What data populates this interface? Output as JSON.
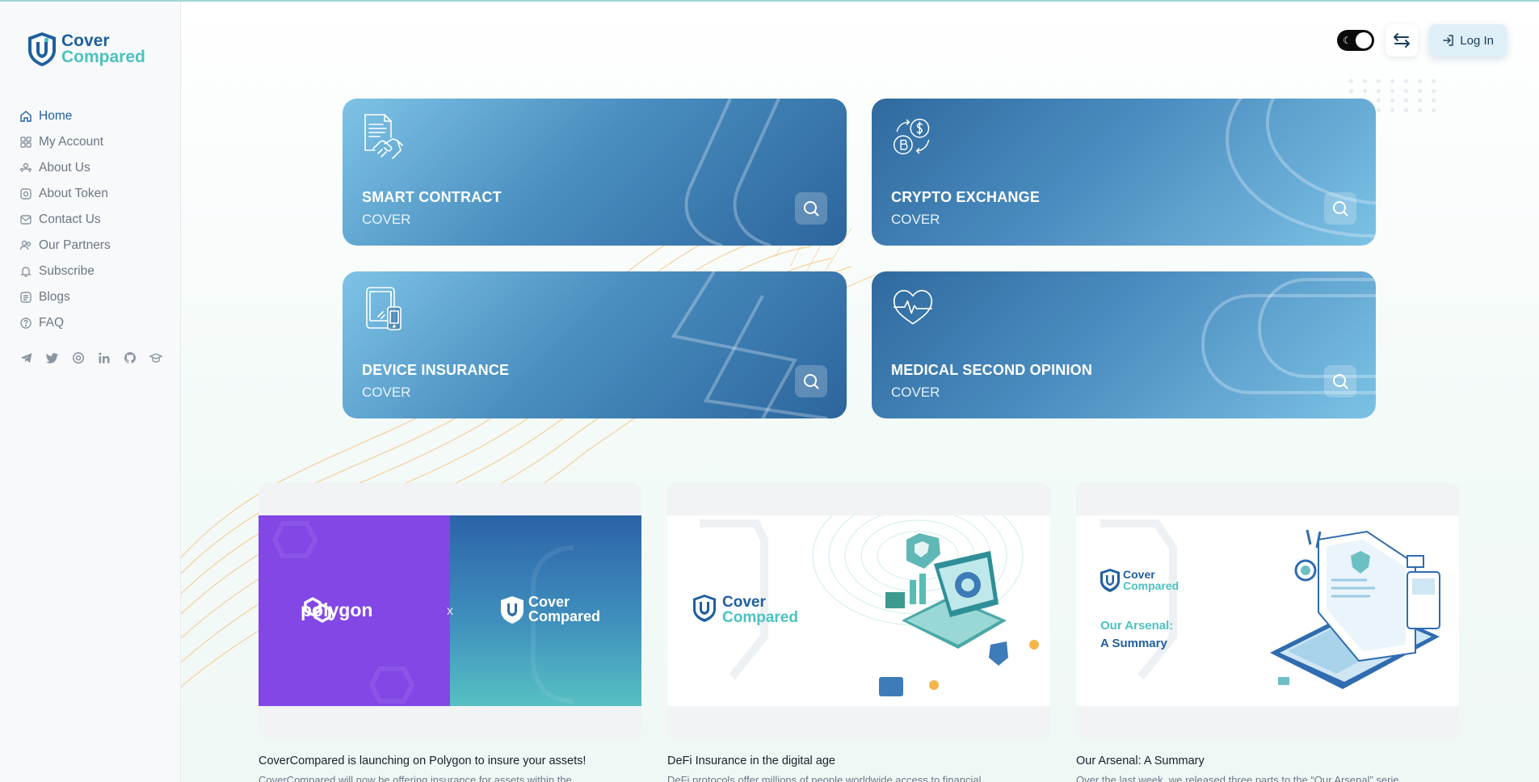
{
  "brand": {
    "line1": "Cover",
    "line2": "Compared"
  },
  "nav": [
    {
      "label": "Home",
      "icon": "home-icon",
      "active": true
    },
    {
      "label": "My Account",
      "icon": "grid-icon"
    },
    {
      "label": "About Us",
      "icon": "users-icon"
    },
    {
      "label": "About Token",
      "icon": "token-icon"
    },
    {
      "label": "Contact Us",
      "icon": "mail-icon"
    },
    {
      "label": "Our Partners",
      "icon": "partners-icon"
    },
    {
      "label": "Subscribe",
      "icon": "bell-icon"
    },
    {
      "label": "Blogs",
      "icon": "blog-icon"
    },
    {
      "label": "FAQ",
      "icon": "help-icon"
    }
  ],
  "socials": [
    "telegram-icon",
    "twitter-icon",
    "instagram-icon",
    "linkedin-icon",
    "github-icon",
    "education-icon"
  ],
  "topbar": {
    "login_label": "Log In",
    "theme_icon": "☾"
  },
  "covers": [
    {
      "title": "SMART CONTRACT",
      "subtitle": "COVER",
      "icon": "contract-handshake-icon"
    },
    {
      "title": "CRYPTO EXCHANGE",
      "subtitle": "COVER",
      "icon": "crypto-exchange-icon"
    },
    {
      "title": "DEVICE INSURANCE",
      "subtitle": "COVER",
      "icon": "device-icon"
    },
    {
      "title": "MEDICAL SECOND OPINION",
      "subtitle": "COVER",
      "icon": "heart-pulse-icon"
    }
  ],
  "blogs": [
    {
      "title": "CoverCompared is launching on Polygon to insure your assets!",
      "excerpt": "CoverCompared will now be offering insurance for assets within the",
      "image_text": {
        "left": "polygon",
        "x": "x",
        "brand1": "Cover",
        "brand2": "Compared"
      }
    },
    {
      "title": "DeFi Insurance in the digital age",
      "excerpt": "DeFi protocols offer millions of people worldwide access to financial",
      "image_text": {
        "brand1": "Cover",
        "brand2": "Compared"
      }
    },
    {
      "title": "Our Arsenal: A Summary",
      "excerpt": "Over the last week, we released three parts to the “Our Arsenal” serie",
      "image_text": {
        "brand1": "Cover",
        "brand2": "Compared",
        "heading1": "Our Arsenal:",
        "heading2": "A Summary"
      }
    }
  ],
  "colors": {
    "primary": "#1f5f9e",
    "accent": "#4cc1c1",
    "polygon": "#8247e5"
  }
}
